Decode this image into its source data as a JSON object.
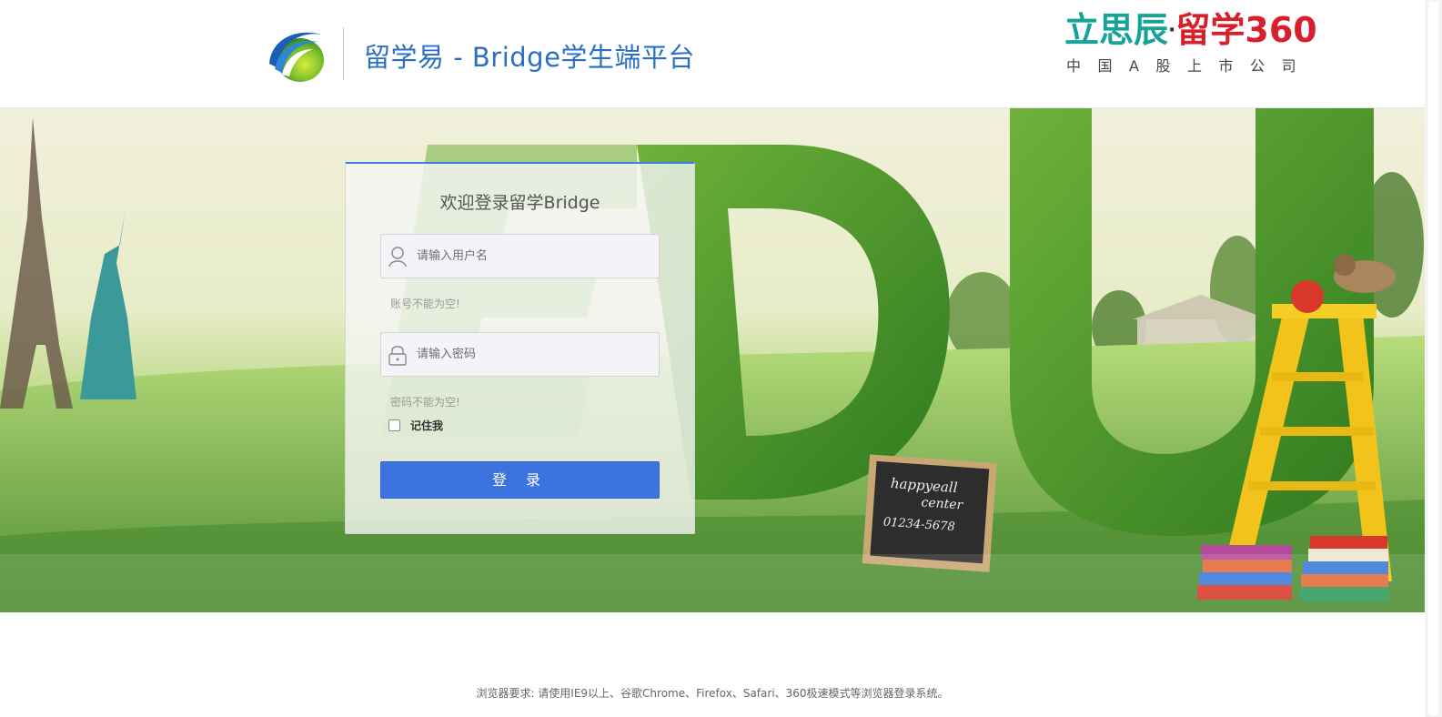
{
  "header": {
    "site_title": "留学易 - Bridge学生端平台",
    "brand_main_a": "立思辰",
    "brand_dot": "·",
    "brand_main_b": "留学360",
    "brand_sub": "中国A股上市公司"
  },
  "banner": {
    "chalkboard_line1": "happyeall",
    "chalkboard_line2": "center",
    "chalkboard_line3": "01234-5678"
  },
  "login": {
    "title": "欢迎登录留学Bridge",
    "username_placeholder": "请输入用户名",
    "username_error": "账号不能为空!",
    "password_placeholder": "请输入密码",
    "password_error": "密码不能为空!",
    "remember_label": "记住我",
    "remember_checked": false,
    "submit_label": "登 录"
  },
  "footer": {
    "browser_note": "浏览器要求: 请使用IE9以上、谷歌Chrome、Firefox、Safari、360极速模式等浏览器登录系统。"
  },
  "colors": {
    "accent": "#3c73de",
    "title_blue": "#2a6fc4",
    "brand_teal": "#15a39a",
    "brand_red": "#d8202d"
  },
  "icons": [
    "app-logo-icon",
    "user-icon",
    "lock-icon"
  ]
}
